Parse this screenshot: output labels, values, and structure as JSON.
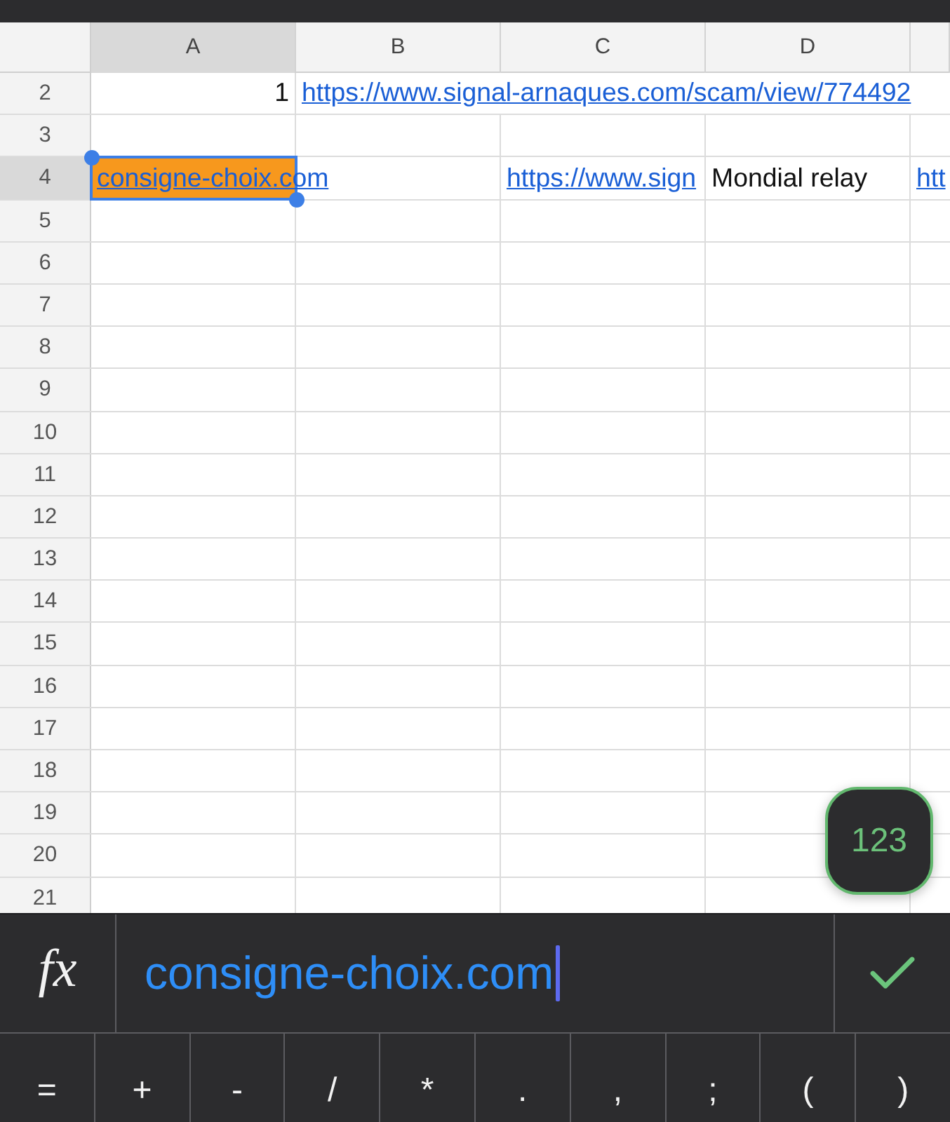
{
  "sheet": {
    "columns": [
      {
        "label": "A",
        "selected": true
      },
      {
        "label": "B",
        "selected": false
      },
      {
        "label": "C",
        "selected": false
      },
      {
        "label": "D",
        "selected": false
      },
      {
        "selected": false
      }
    ],
    "rows": [
      {
        "label": "2",
        "selected": false,
        "cells": [
          {
            "text": "1",
            "kind": "number"
          },
          {
            "text": "https://www.signal-arnaques.com/scam/view/774492",
            "kind": "link"
          }
        ]
      },
      {
        "label": "3",
        "selected": false
      },
      {
        "label": "4",
        "selected": true,
        "cells": [
          {
            "text": "consigne-choix.com",
            "kind": "link",
            "color": "#f7981d"
          },
          null,
          {
            "text": "https://www.sign",
            "kind": "link"
          },
          {
            "text": "Mondial relay",
            "kind": "text"
          },
          {
            "text": "htt",
            "kind": "link"
          }
        ]
      },
      {
        "label": "5",
        "selected": false
      },
      {
        "label": "6",
        "selected": false
      },
      {
        "label": "7",
        "selected": false
      },
      {
        "label": "8",
        "selected": false
      },
      {
        "label": "9",
        "selected": false
      },
      {
        "label": "10",
        "selected": false
      },
      {
        "label": "11",
        "selected": false
      },
      {
        "label": "12",
        "selected": false
      },
      {
        "label": "13",
        "selected": false
      },
      {
        "label": "14",
        "selected": false
      },
      {
        "label": "15",
        "selected": false
      },
      {
        "label": "16",
        "selected": false
      },
      {
        "label": "17",
        "selected": false
      },
      {
        "label": "18",
        "selected": false
      },
      {
        "label": "19",
        "selected": false
      },
      {
        "label": "20",
        "selected": false
      },
      {
        "label": "21",
        "selected": false
      }
    ]
  },
  "floating_button": {
    "label": "123"
  },
  "formula_bar": {
    "function_label": "fx",
    "value": "consigne-choix.com"
  },
  "keyboard": {
    "keys": [
      "=",
      "+",
      "-",
      "/",
      "*",
      ".",
      ",",
      ";",
      "(",
      ")"
    ]
  }
}
